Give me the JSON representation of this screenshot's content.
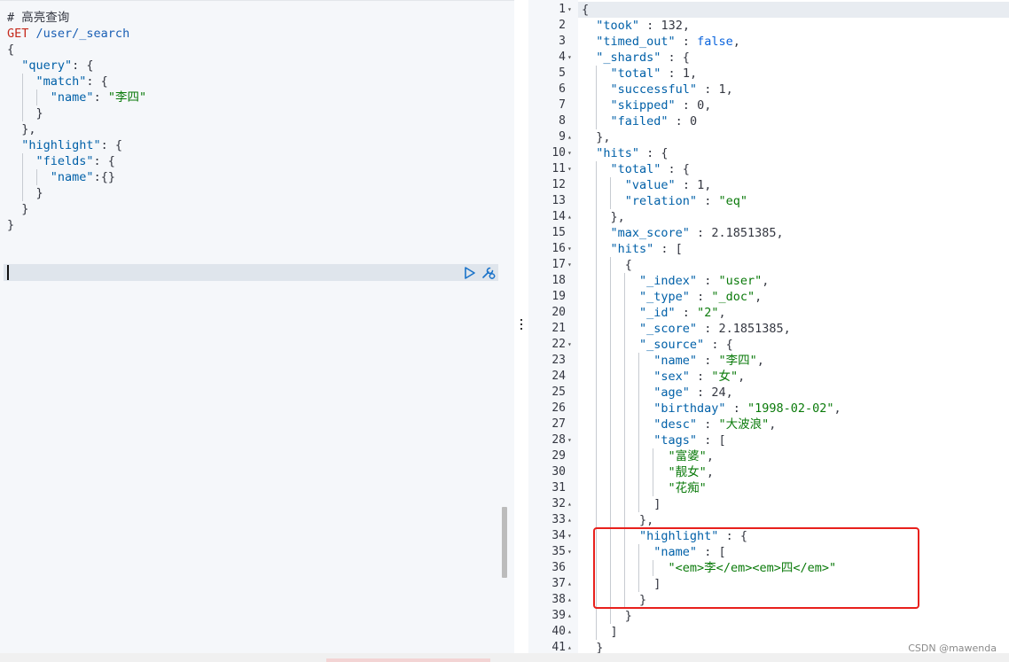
{
  "request": {
    "comment": "# 高亮查询",
    "method": "GET",
    "path": "/user/_search",
    "k_query": "\"query\"",
    "k_match": "\"match\"",
    "k_name": "\"name\"",
    "v_name": "\"李四\"",
    "k_highlight": "\"highlight\"",
    "k_fields": "\"fields\"",
    "k_name2": "\"name\""
  },
  "response": {
    "line_numbers": [
      "1",
      "2",
      "3",
      "4",
      "5",
      "6",
      "7",
      "8",
      "9",
      "10",
      "11",
      "12",
      "13",
      "14",
      "15",
      "16",
      "17",
      "18",
      "19",
      "20",
      "21",
      "22",
      "23",
      "24",
      "25",
      "26",
      "27",
      "28",
      "29",
      "30",
      "31",
      "32",
      "33",
      "34",
      "35",
      "36",
      "37",
      "38",
      "39",
      "40",
      "41"
    ],
    "took_value": "132",
    "timed_out_value": "false",
    "shards_total": "1",
    "shards_successful": "1",
    "shards_skipped": "0",
    "shards_failed": "0",
    "hits_total_value": "1",
    "hits_total_relation": "\"eq\"",
    "max_score": "2.1851385",
    "doc_index": "\"user\"",
    "doc_type": "\"_doc\"",
    "doc_id": "\"2\"",
    "doc_score": "2.1851385",
    "source_name": "\"李四\"",
    "source_sex": "\"女\"",
    "source_age": "24",
    "source_birthday": "\"1998-02-02\"",
    "source_desc": "\"大波浪\"",
    "source_tags": [
      "\"富婆\"",
      "\"靓女\"",
      "\"花痴\""
    ],
    "highlight_name_value": "\"<em>李</em><em>四</em>\""
  },
  "keys": {
    "took": "\"took\"",
    "timed_out": "\"timed_out\"",
    "shards": "\"_shards\"",
    "total": "\"total\"",
    "successful": "\"successful\"",
    "skipped": "\"skipped\"",
    "failed": "\"failed\"",
    "hits": "\"hits\"",
    "value": "\"value\"",
    "relation": "\"relation\"",
    "max_score": "\"max_score\"",
    "index": "\"_index\"",
    "type": "\"_type\"",
    "id": "\"_id\"",
    "score": "\"_score\"",
    "source": "\"_source\"",
    "name": "\"name\"",
    "sex": "\"sex\"",
    "age": "\"age\"",
    "birthday": "\"birthday\"",
    "desc": "\"desc\"",
    "tags": "\"tags\"",
    "highlight": "\"highlight\""
  },
  "icons": {
    "run": "play-icon",
    "settings": "wrench-icon",
    "splitter": "vertical-dots-icon"
  },
  "colors": {
    "highlight_box": "#e8201c",
    "method": "#c5291c",
    "string": "#0a7a0a",
    "key": "#0060a8"
  },
  "watermark": "CSDN @mawenda"
}
